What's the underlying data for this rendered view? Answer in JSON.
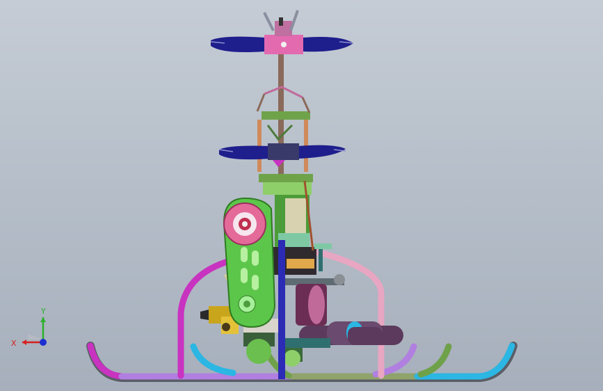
{
  "viewport": {
    "background_top": "#c5ccd5",
    "background_bottom": "#a6afbb"
  },
  "triad": {
    "x_label": "X",
    "y_label": "Y",
    "x_color": "#d81e1e",
    "y_color": "#2bb02b",
    "z_color": "#1b2fd0"
  },
  "model": {
    "rotor_blade_color": "#1e1e8c",
    "main_frame_color": "#7ee24b",
    "pulley_color": "#e46a9a",
    "skid_colors": [
      "#b07fe0",
      "#2bb6e3",
      "#6fa14a",
      "#e8a6c2",
      "#c833c0"
    ]
  }
}
